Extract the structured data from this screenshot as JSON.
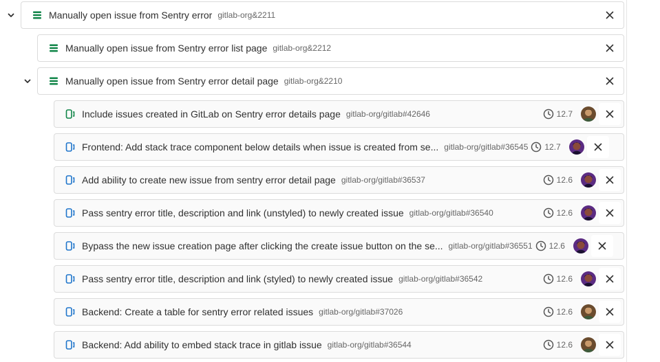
{
  "colors": {
    "epic_icon": "#108548",
    "issue_open_icon": "#108548",
    "issue_closed_icon": "#1f75cb",
    "avatar_a": "#6b4c2e",
    "avatar_b": "#5b2b82"
  },
  "epics": [
    {
      "title": "Manually open issue from Sentry error",
      "ref": "gitlab-org&2211",
      "icon": "epic-icon",
      "expanded": true
    },
    {
      "title": "Manually open issue from Sentry error list page",
      "ref": "gitlab-org&2212",
      "icon": "epic-icon",
      "expanded": false
    },
    {
      "title": "Manually open issue from Sentry error detail page",
      "ref": "gitlab-org&2210",
      "icon": "epic-icon",
      "expanded": true
    }
  ],
  "issues": [
    {
      "title": "Include issues created in GitLab on Sentry error details page",
      "ref": "gitlab-org/gitlab#42646",
      "milestone": "12.7",
      "state": "open",
      "icon": "issue-open-icon",
      "avatar": "avatar_a"
    },
    {
      "title": "Frontend: Add stack trace component below details when issue is created from se...",
      "ref": "gitlab-org/gitlab#36545",
      "milestone": "12.7",
      "state": "closed",
      "icon": "issue-closed-icon",
      "avatar": "avatar_b"
    },
    {
      "title": "Add ability to create new issue from sentry error detail page",
      "ref": "gitlab-org/gitlab#36537",
      "milestone": "12.6",
      "state": "closed",
      "icon": "issue-closed-icon",
      "avatar": "avatar_b"
    },
    {
      "title": "Pass sentry error title, description and link (unstyled) to newly created issue",
      "ref": "gitlab-org/gitlab#36540",
      "milestone": "12.6",
      "state": "closed",
      "icon": "issue-closed-icon",
      "avatar": "avatar_b"
    },
    {
      "title": "Bypass the new issue creation page after clicking the create issue button on the se...",
      "ref": "gitlab-org/gitlab#36551",
      "milestone": "12.6",
      "state": "closed",
      "icon": "issue-closed-icon",
      "avatar": "avatar_b"
    },
    {
      "title": "Pass sentry error title, description and link (styled) to newly created issue",
      "ref": "gitlab-org/gitlab#36542",
      "milestone": "12.6",
      "state": "closed",
      "icon": "issue-closed-icon",
      "avatar": "avatar_b"
    },
    {
      "title": "Backend: Create a table for sentry error related issues",
      "ref": "gitlab-org/gitlab#37026",
      "milestone": "12.6",
      "state": "closed",
      "icon": "issue-closed-icon",
      "avatar": "avatar_a"
    },
    {
      "title": "Backend: Add ability to embed stack trace in gitlab issue",
      "ref": "gitlab-org/gitlab#36544",
      "milestone": "12.6",
      "state": "closed",
      "icon": "issue-closed-icon",
      "avatar": "avatar_a"
    }
  ]
}
